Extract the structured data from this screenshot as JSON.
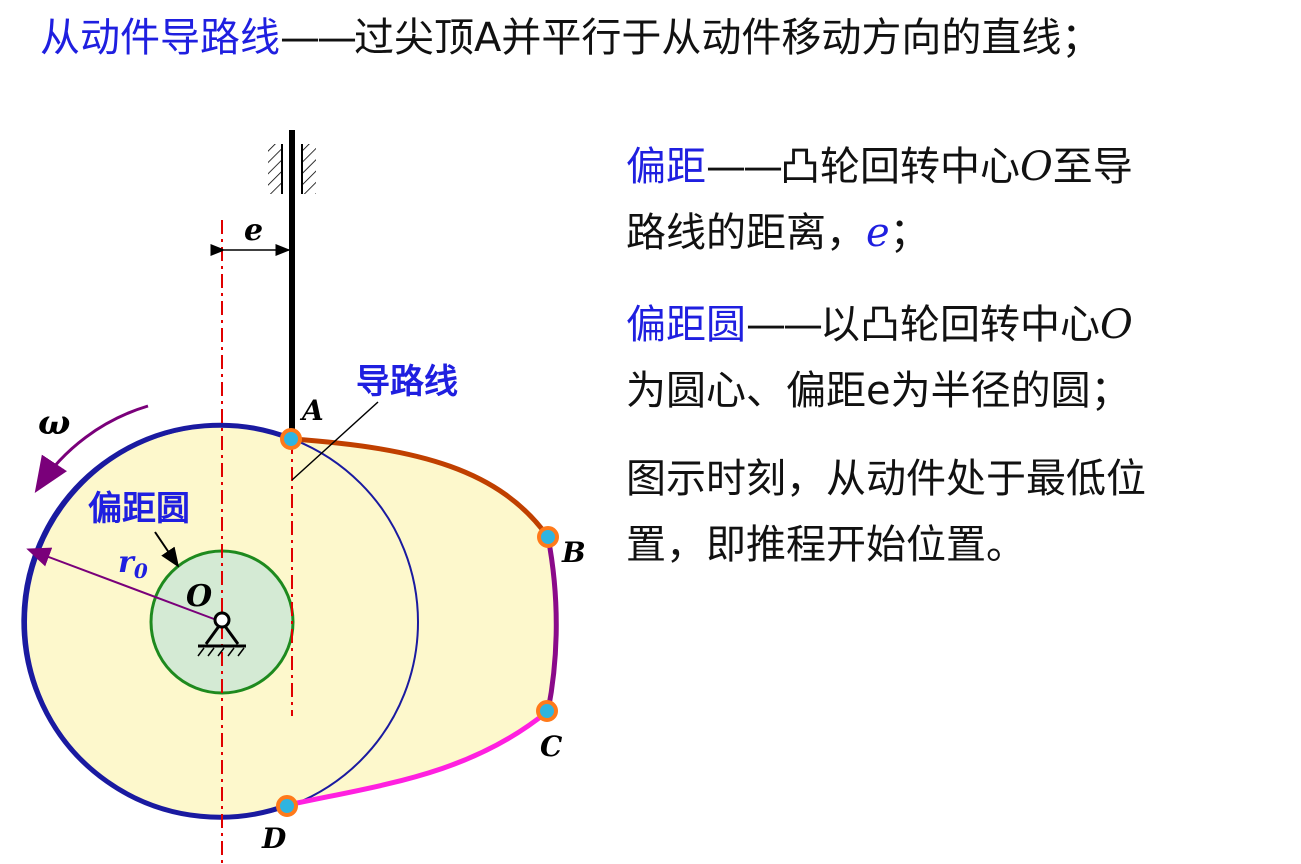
{
  "title": {
    "term": "从动件导路线",
    "dash": "——",
    "definition": "过尖顶A并平行于从动件移动方向的直线；"
  },
  "offset": {
    "term": "偏距",
    "dash": "——",
    "def_part1": "凸轮回转中心",
    "def_o": "O",
    "def_part2": "至导",
    "def_part3": "路线的距离，",
    "def_e": "e",
    "def_end": "；"
  },
  "offset_circle": {
    "term": "偏距圆",
    "dash": "——",
    "def_part1": "以凸轮回转中心",
    "def_o": "O",
    "def_part2": "为圆心、偏距e为半径的圆；"
  },
  "note": {
    "line1": "图示时刻，从动件处于最低位",
    "line2": "置，即推程开始位置。"
  },
  "diagram": {
    "label_e": "e",
    "label_guide": "导路线",
    "label_omega": "ω",
    "label_offset_circle": "偏距圆",
    "label_r": "r",
    "label_r_sub": "0",
    "label_o": "O",
    "label_a": "A",
    "label_b": "B",
    "label_c": "C",
    "label_d": "D",
    "colors": {
      "cam_fill": "#fdf8cc",
      "base_circle": "#1a1aa0",
      "offset_circle": "#1e8a1e",
      "offset_fill": "#d4ead4",
      "rise": "#c04000",
      "far_dwell": "#8a0a8a",
      "return": "#ff20e0",
      "point": "#ff7a1a",
      "point_center": "#2fb4e0",
      "center_line": "#e00000",
      "omega_arrow": "#7a007a"
    }
  }
}
